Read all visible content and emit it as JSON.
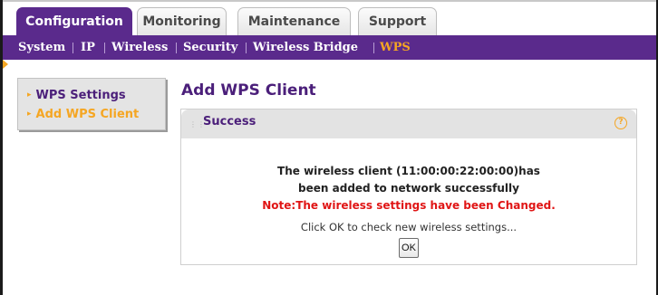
{
  "tabs": [
    {
      "label": "Configuration",
      "active": true
    },
    {
      "label": "Monitoring",
      "active": false
    },
    {
      "label": "Maintenance",
      "active": false
    },
    {
      "label": "Support",
      "active": false
    }
  ],
  "subnav": [
    {
      "label": "System",
      "active": false
    },
    {
      "label": "IP",
      "active": false
    },
    {
      "label": "Wireless",
      "active": false
    },
    {
      "label": "Security",
      "active": false
    },
    {
      "label": "Wireless Bridge",
      "active": false
    },
    {
      "label": "WPS",
      "active": true
    }
  ],
  "leftmenu": [
    {
      "label": "WPS Settings",
      "current": false
    },
    {
      "label": "Add WPS Client",
      "current": true
    }
  ],
  "main": {
    "title": "Add WPS Client",
    "panel_title": "Success",
    "help_label": "?",
    "message_line1": "The wireless client (11:00:00:22:00:00)has",
    "message_line2": "been added to network successfully",
    "note": "Note:The wireless settings have been Changed.",
    "hint": "Click OK to check new wireless settings...",
    "ok_label": "OK"
  },
  "colors": {
    "brand_purple": "#5a2a8c",
    "accent_orange": "#f5a623",
    "note_red": "#e01515"
  }
}
